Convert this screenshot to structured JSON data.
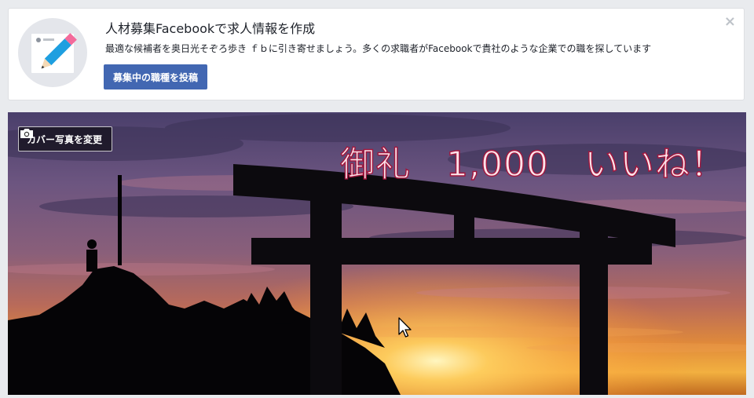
{
  "promo": {
    "title": "人材募集Facebookで求人情報を作成",
    "description": "最適な候補者を奥日光そぞろ歩き ｆｂに引き寄せましょう。多くの求職者がFacebookで貴社のような企業での職を探しています",
    "button_label": "募集中の職種を投稿",
    "close_label": "×",
    "icon": "pencil-edit-icon",
    "accent_color": "#4267b2"
  },
  "cover": {
    "change_button_label": "カバー写真を変更",
    "camera_icon": "camera-icon",
    "overlay_text": "御礼　1,000　いいね！",
    "photo_description": ""
  }
}
